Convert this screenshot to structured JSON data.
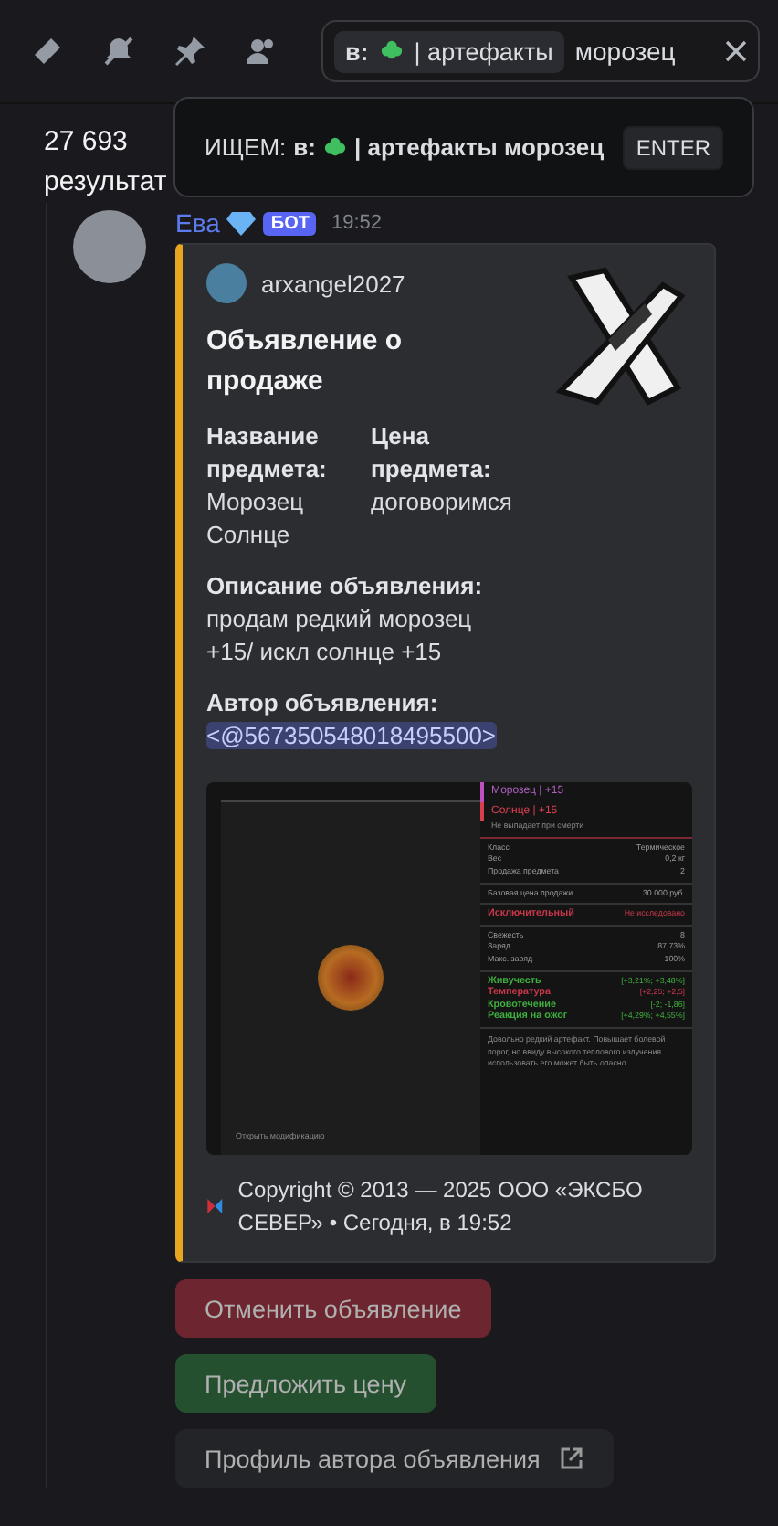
{
  "search": {
    "filter_label": "в:",
    "filter_channel": "| артефакты",
    "value": "морозец"
  },
  "search_popup": {
    "prefix": "ИЩЕМ:",
    "filter_label": "в:",
    "query": "| артефакты морозец",
    "key": "ENTER"
  },
  "results": {
    "count": "27 693",
    "label": "результат"
  },
  "message": {
    "author": "Ева",
    "badge": "БОТ",
    "time": "19:52",
    "embed": {
      "author": "arxangel2027",
      "title": "Объявление о продаже",
      "fields": [
        {
          "name": "Название предмета:",
          "value": "Морозец Солнце",
          "inline": true
        },
        {
          "name": "Цена предмета:",
          "value": "договоримся",
          "inline": true
        },
        {
          "name": "Описание объявления:",
          "value": "продам редкий морозец +15/ искл солнце +15",
          "inline": false
        },
        {
          "name": "Автор объявления:",
          "value": "<@567350548018495500>",
          "inline": false,
          "mention": true
        }
      ],
      "image": {
        "back_title": "Морозец | +15",
        "title": "Солнце | +15",
        "subtitle": "Не выпадает при смерти",
        "groups": [
          [
            {
              "label": "Класс",
              "value": "Термическое"
            },
            {
              "label": "Вес",
              "value": "0,2 кг"
            },
            {
              "label": "Продажа предмета",
              "value": "2"
            }
          ],
          [
            {
              "label": "Базовая цена продажи",
              "value": "30 000 руб."
            }
          ],
          [
            {
              "label": "Исключительный",
              "value": "Не исследовано",
              "color": "#c8384a"
            }
          ],
          [
            {
              "label": "Свежесть",
              "value": "8"
            },
            {
              "label": "Заряд",
              "value": "87,73%"
            },
            {
              "label": "Макс. заряд",
              "value": "100%"
            }
          ],
          [
            {
              "label": "Живучесть",
              "value": "[+3,21%; +3,48%]",
              "color": "#3fae3f"
            },
            {
              "label": "Температура",
              "value": "[+2,25; +2,5]",
              "color": "#c8384a"
            },
            {
              "label": "Кровотечение",
              "value": "[-2; -1,86]",
              "color": "#3fae3f"
            },
            {
              "label": "Реакция на ожог",
              "value": "[+4,29%; +4,55%]",
              "color": "#3fae3f"
            }
          ]
        ],
        "description": "Довольно редкий артефакт. Повышает болевой порог, но ввиду высокого теплового излучения использовать его может быть опасно.",
        "hint": "Открыть модификацию"
      },
      "footer": "Copyright © 2013 — 2025 ООО «ЭКСБО СЕВЕР» • Сегодня, в 19:52"
    },
    "buttons": [
      {
        "label": "Отменить объявление",
        "kind": "danger"
      },
      {
        "label": "Предложить цену",
        "kind": "success"
      },
      {
        "label": "Профиль автора объявления",
        "kind": "link"
      }
    ]
  }
}
